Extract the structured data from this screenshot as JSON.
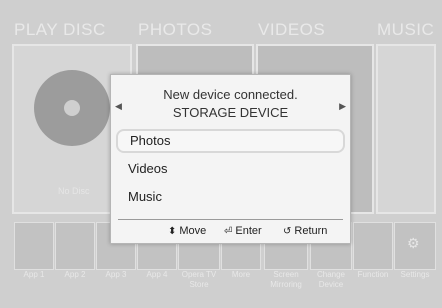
{
  "categories": [
    "PLAY DISC",
    "PHOTOS",
    "VIDEOS",
    "MUSIC"
  ],
  "no_disc_label": "No Disc",
  "apps": [
    "App 1",
    "App 2",
    "App 3",
    "App 4",
    "Opera TV Store",
    "More",
    "Screen Mirroring",
    "Change Device",
    "Function",
    "Settings"
  ],
  "dialog": {
    "title": "New device connected.",
    "subtitle": "STORAGE DEVICE",
    "options": [
      "Photos",
      "Videos",
      "Music"
    ],
    "selected_index": 0,
    "footer": {
      "move": "Move",
      "enter": "Enter",
      "return": "Return"
    }
  },
  "icons": {
    "left_arrow": "caret-left-icon",
    "right_arrow": "caret-right-icon",
    "move": "up-down-arrows-icon",
    "enter": "enter-icon",
    "return": "return-icon"
  }
}
